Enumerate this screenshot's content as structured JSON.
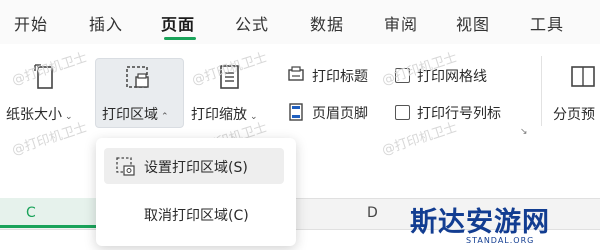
{
  "tabs": [
    {
      "label": "开始"
    },
    {
      "label": "插入"
    },
    {
      "label": "页面",
      "active": true
    },
    {
      "label": "公式"
    },
    {
      "label": "数据"
    },
    {
      "label": "审阅"
    },
    {
      "label": "视图"
    },
    {
      "label": "工具"
    }
  ],
  "ribbon": {
    "paper_size": "纸张大小",
    "print_area": "打印区域",
    "print_scale": "打印缩放",
    "print_titles": "打印标题",
    "header_footer": "页眉页脚",
    "print_gridlines": "打印网格线",
    "print_row_col_labels": "打印行号列标",
    "page_break_preview": "分页预"
  },
  "dropdown": {
    "set_print_area": "设置打印区域(S)",
    "cancel_print_area": "取消打印区域(C)"
  },
  "sheet": {
    "columns": [
      "C",
      "D"
    ]
  },
  "watermark": {
    "text": "@打印机卫士"
  },
  "brand": {
    "name": "斯达安游网",
    "url": "STANDAL.ORG"
  },
  "colors": {
    "accent": "#1aa35a",
    "brand": "#123d91"
  }
}
